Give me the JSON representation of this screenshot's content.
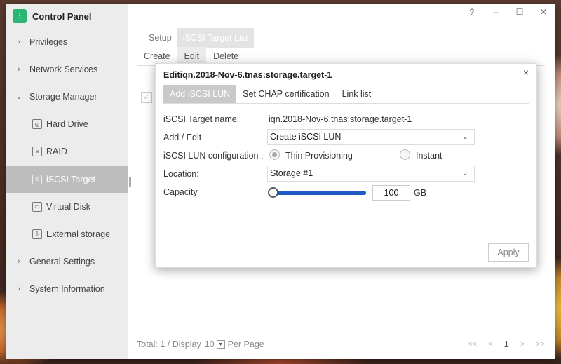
{
  "window": {
    "title": "Control Panel",
    "controls": [
      "?",
      "–",
      "☐",
      "✕"
    ]
  },
  "sidebar": {
    "items": [
      {
        "label": "Privileges",
        "chevron": "›"
      },
      {
        "label": "Network Services",
        "chevron": "›"
      },
      {
        "label": "Storage Manager",
        "chevron": "⌄"
      },
      {
        "label": "General Settings",
        "chevron": "›"
      },
      {
        "label": "System Information",
        "chevron": "›"
      }
    ],
    "storage_children": [
      {
        "label": "Hard Drive",
        "icon": "hard-drive-icon"
      },
      {
        "label": "RAID",
        "icon": "raid-icon"
      },
      {
        "label": "iSCSI Target",
        "icon": "iscsi-icon",
        "active": true
      },
      {
        "label": "Virtual Disk",
        "icon": "virtual-disk-icon"
      },
      {
        "label": "External storage",
        "icon": "external-storage-icon"
      }
    ]
  },
  "tabs": [
    "Setup",
    "iSCSI Target List"
  ],
  "toolbar": {
    "create": "Create",
    "edit": "Edit",
    "delete": "Delete"
  },
  "footer": {
    "total_label": "Total: 1 / Display",
    "per_page_value": "10",
    "per_page_label": "Per Page",
    "pager": {
      "first": "<<",
      "prev": "<",
      "page": "1",
      "next": ">",
      "last": ">>"
    }
  },
  "dialog": {
    "title": "Editiqn.2018-Nov-6.tnas:storage.target-1",
    "close": "×",
    "tabs": [
      "Add iSCSI LUN",
      "Set CHAP certification",
      "Link list"
    ],
    "target_name_label": "iSCSI Target name:",
    "target_name_value": "iqn.2018-Nov-6.tnas:storage.target-1",
    "add_edit_label": "Add / Edit",
    "add_edit_value": "Create iSCSI LUN",
    "lun_config_label": "iSCSI LUN configuration :",
    "lun_options": [
      "Thin Provisioning",
      "Instant"
    ],
    "lun_selected": "Thin Provisioning",
    "location_label": "Location:",
    "location_value": "Storage #1",
    "capacity_label": "Capacity",
    "capacity_value": "100",
    "capacity_unit": "GB",
    "capacity_slider_level": 0,
    "apply": "Apply"
  },
  "colors": {
    "accent_green": "#2bb673",
    "slider_blue": "#1f5bc4",
    "active_nav": "#bdbdbd"
  }
}
